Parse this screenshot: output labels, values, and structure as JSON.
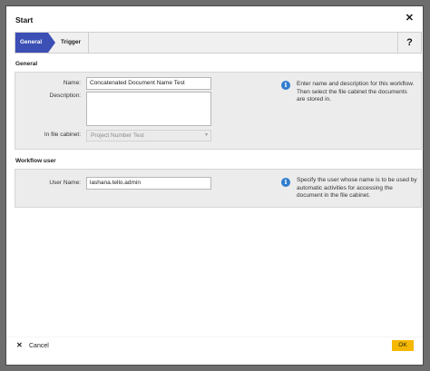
{
  "window": {
    "title": "Start",
    "close_glyph": "✕"
  },
  "tabs": [
    {
      "label": "General",
      "active": true
    },
    {
      "label": "Trigger",
      "active": false
    }
  ],
  "toolbar": {
    "help_label": "?"
  },
  "general": {
    "section_title": "General",
    "name_label": "Name:",
    "name_value": "Concatenated Document Name Test",
    "description_label": "Description:",
    "description_value": "",
    "cabinet_label": "In file cabinet:",
    "cabinet_value": "Project Number Test",
    "info_icon": "info-icon",
    "info_text": "Enter name and description for this workflow. Then select the file cabinet the documents are stored in."
  },
  "workflow_user": {
    "section_title": "Workflow user",
    "user_label": "User Name:",
    "user_value": "lashana.tello.admin",
    "info_text": "Specify the user whose name is to be used by automatic activities for accessing the document in the file cabinet."
  },
  "footer": {
    "cancel_label": "Cancel",
    "ok_label": "OK"
  },
  "colors": {
    "accent_tab": "#3b4fb5",
    "ok_button": "#f5b800",
    "info_icon": "#2f7ccf"
  }
}
